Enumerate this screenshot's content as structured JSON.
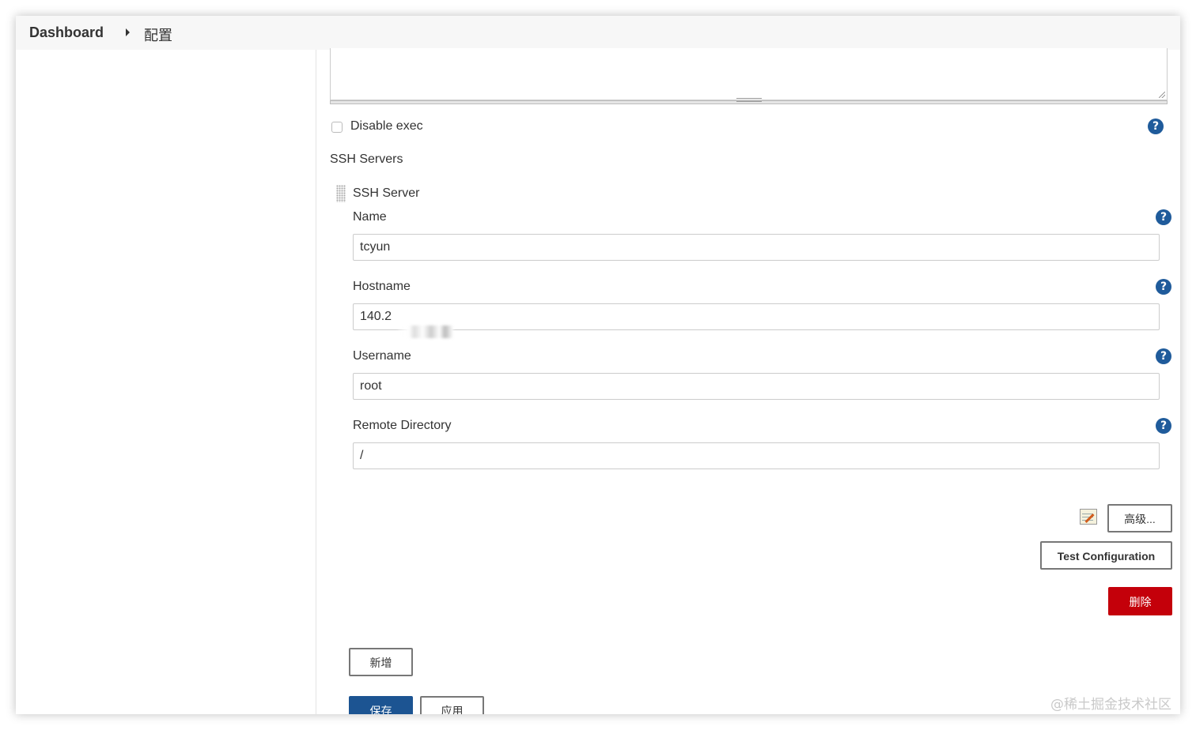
{
  "breadcrumb": {
    "dashboard": "Dashboard",
    "current": "配置"
  },
  "disable_exec": {
    "label": "Disable exec",
    "checked": false
  },
  "ssh_servers": {
    "section_title": "SSH Servers",
    "server_title": "SSH Server",
    "fields": {
      "name": {
        "label": "Name",
        "value": "tcyun"
      },
      "hostname": {
        "label": "Hostname",
        "value": "140.2"
      },
      "username": {
        "label": "Username",
        "value": "root"
      },
      "remote_directory": {
        "label": "Remote Directory",
        "value": "/"
      }
    },
    "advanced_button": "高级...",
    "test_button": "Test Configuration",
    "delete_button": "删除"
  },
  "add_button": "新增",
  "save_button": "保存",
  "apply_button": "应用",
  "help_icon_glyph": "?",
  "watermark": "@稀土掘金技术社区",
  "colors": {
    "help_icon": "#1f5b9b",
    "save_button": "#1c5492",
    "delete_button": "#c4000a",
    "breadcrumb_bar": "#f7f7f7"
  },
  "icons": [
    "chevron-right-icon",
    "help-icon",
    "drag-handle-icon",
    "notepad-icon"
  ]
}
